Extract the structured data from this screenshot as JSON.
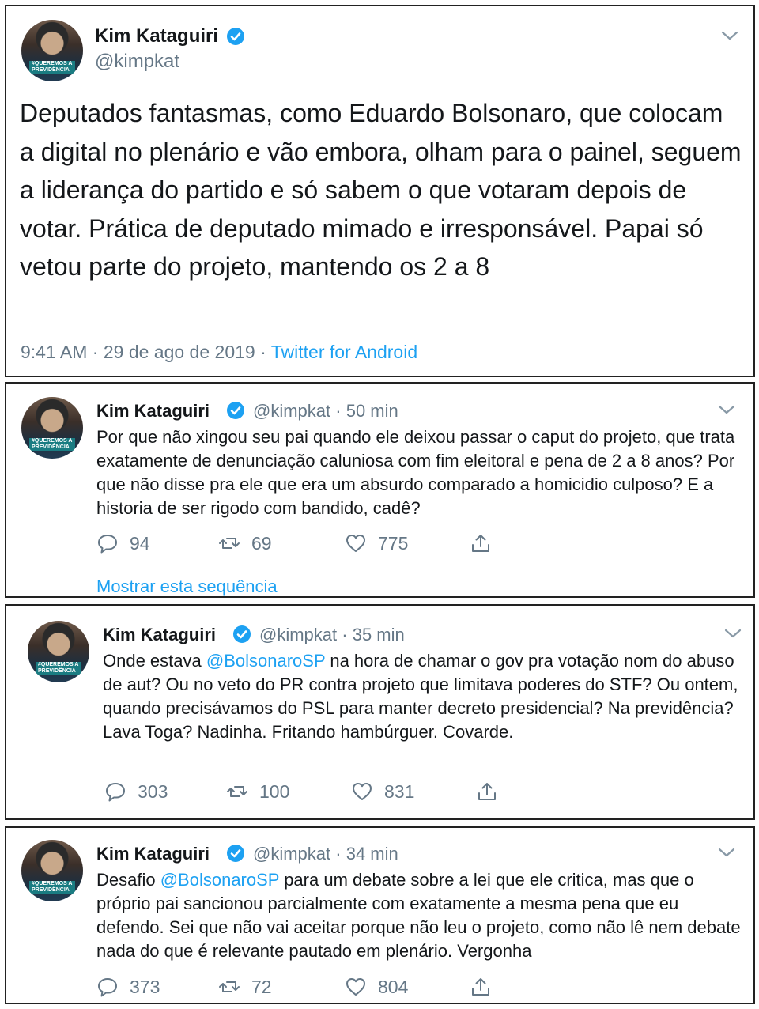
{
  "main_tweet": {
    "name": "Kim Kataguiri",
    "handle": "@kimpkat",
    "text": "Deputados fantasmas, como Eduardo Bolsonaro, que colocam a digital no plenário e vão embora, olham para o painel, seguem a liderança do partido e só sabem o que votaram depois de votar. Prática de deputado mimado e irresponsável. Papai só vetou parte do projeto, mantendo os 2 a 8",
    "time": "9:41 AM",
    "date": "29 de ago de 2019",
    "separator": "·",
    "source": "Twitter for Android"
  },
  "tweets": [
    {
      "name": "Kim Kataguiri",
      "handle": "@kimpkat",
      "age": "50 min",
      "text_before": "Por que não xingou seu pai quando ele deixou passar o caput do projeto, que trata exatamente de denunciação caluniosa com fim eleitoral e pena de 2 a 8 anos? Por que não disse pra ele que era um absurdo comparado a homicidio culposo? E a historia de ser rigodo com bandido, cadê?",
      "mention": "",
      "text_after": "",
      "replies": "94",
      "retweets": "69",
      "likes": "775",
      "thread_link": "Mostrar esta sequência"
    },
    {
      "name": "Kim Kataguiri",
      "handle": "@kimpkat",
      "age": "35 min",
      "text_before": "Onde estava ",
      "mention": "@BolsonaroSP",
      "text_after": " na hora de chamar o gov pra votação nom do abuso de aut? Ou no veto do PR contra projeto que limitava poderes do STF? Ou ontem, quando precisávamos do PSL para manter decreto presidencial? Na previdência? Lava Toga? Nadinha. Fritando hambúrguer. Covarde.",
      "replies": "303",
      "retweets": "100",
      "likes": "831"
    },
    {
      "name": "Kim Kataguiri",
      "handle": "@kimpkat",
      "age": "34 min",
      "text_before": "Desafio ",
      "mention": "@BolsonaroSP",
      "text_after": " para um debate sobre a lei que ele critica, mas que o próprio pai sancionou parcialmente com exatamente a mesma pena que eu defendo. Sei que não vai aceitar porque não leu o projeto, como não lê nem debate nada do que é relevante pautado em plenário. Vergonha",
      "replies": "373",
      "retweets": "72",
      "likes": "804"
    }
  ],
  "avatar_badge": "#QUEREMOS A PREVIDÊNCIA",
  "colors": {
    "link": "#1da1f2",
    "muted": "#657786",
    "text": "#14171a",
    "verified": "#1da1f2"
  },
  "icons": [
    "chevron-down-icon",
    "verified-badge-icon",
    "reply-icon",
    "retweet-icon",
    "like-icon",
    "share-icon"
  ]
}
